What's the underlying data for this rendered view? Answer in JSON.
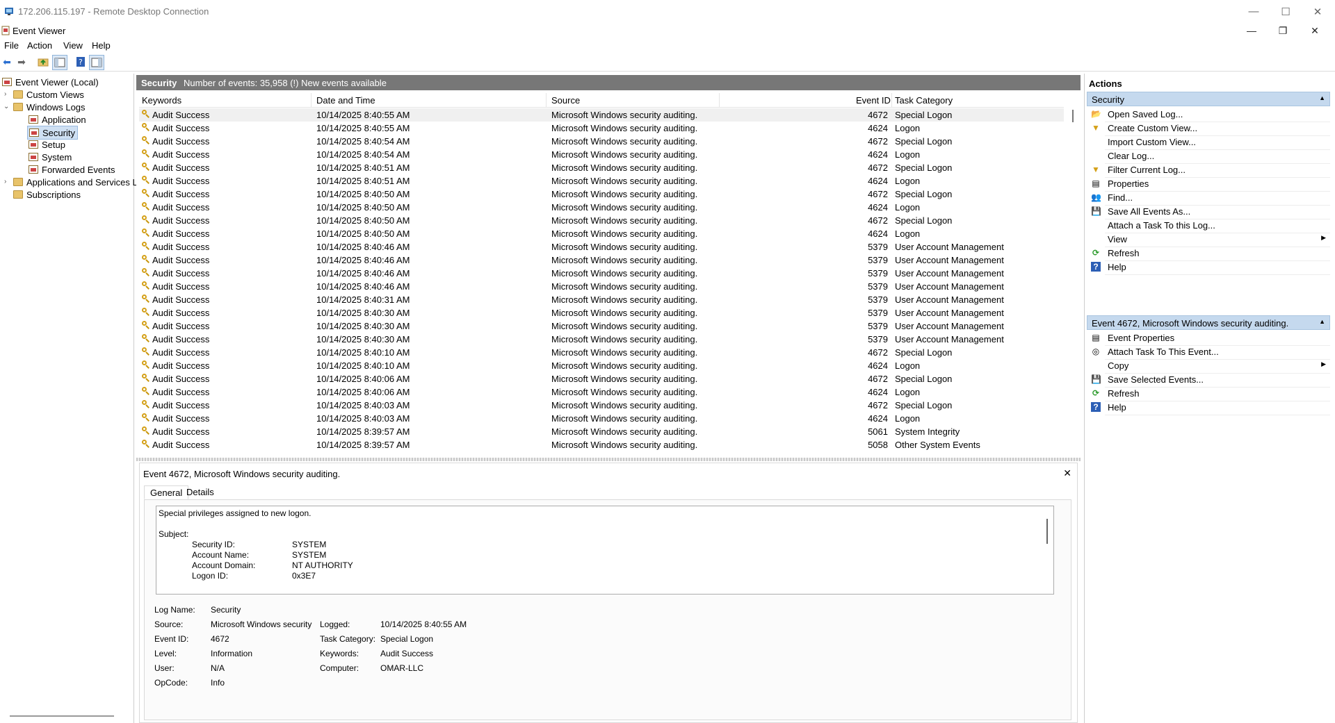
{
  "rdp": {
    "title": "172.206.115.197 - Remote Desktop Connection",
    "minimize": "—",
    "maximize": "☐",
    "close": "✕"
  },
  "app": {
    "title": "Event Viewer",
    "minimize": "—",
    "restore": "❐",
    "close": "✕"
  },
  "menu": [
    "File",
    "Action",
    "View",
    "Help"
  ],
  "tree": {
    "root": "Event Viewer (Local)",
    "custom_views": "Custom Views",
    "windows_logs": "Windows Logs",
    "application": "Application",
    "security": "Security",
    "setup": "Setup",
    "system": "System",
    "forwarded": "Forwarded Events",
    "apps_services": "Applications and Services Lo",
    "subscriptions": "Subscriptions"
  },
  "list": {
    "log_name": "Security",
    "summary": "Number of events: 35,958 (!) New events available",
    "columns": [
      "Keywords",
      "Date and Time",
      "Source",
      "Event ID",
      "Task Category"
    ],
    "rows": [
      [
        "Audit Success",
        "10/14/2025 8:40:55 AM",
        "Microsoft Windows security auditing.",
        "4672",
        "Special Logon"
      ],
      [
        "Audit Success",
        "10/14/2025 8:40:55 AM",
        "Microsoft Windows security auditing.",
        "4624",
        "Logon"
      ],
      [
        "Audit Success",
        "10/14/2025 8:40:54 AM",
        "Microsoft Windows security auditing.",
        "4672",
        "Special Logon"
      ],
      [
        "Audit Success",
        "10/14/2025 8:40:54 AM",
        "Microsoft Windows security auditing.",
        "4624",
        "Logon"
      ],
      [
        "Audit Success",
        "10/14/2025 8:40:51 AM",
        "Microsoft Windows security auditing.",
        "4672",
        "Special Logon"
      ],
      [
        "Audit Success",
        "10/14/2025 8:40:51 AM",
        "Microsoft Windows security auditing.",
        "4624",
        "Logon"
      ],
      [
        "Audit Success",
        "10/14/2025 8:40:50 AM",
        "Microsoft Windows security auditing.",
        "4672",
        "Special Logon"
      ],
      [
        "Audit Success",
        "10/14/2025 8:40:50 AM",
        "Microsoft Windows security auditing.",
        "4624",
        "Logon"
      ],
      [
        "Audit Success",
        "10/14/2025 8:40:50 AM",
        "Microsoft Windows security auditing.",
        "4672",
        "Special Logon"
      ],
      [
        "Audit Success",
        "10/14/2025 8:40:50 AM",
        "Microsoft Windows security auditing.",
        "4624",
        "Logon"
      ],
      [
        "Audit Success",
        "10/14/2025 8:40:46 AM",
        "Microsoft Windows security auditing.",
        "5379",
        "User Account Management"
      ],
      [
        "Audit Success",
        "10/14/2025 8:40:46 AM",
        "Microsoft Windows security auditing.",
        "5379",
        "User Account Management"
      ],
      [
        "Audit Success",
        "10/14/2025 8:40:46 AM",
        "Microsoft Windows security auditing.",
        "5379",
        "User Account Management"
      ],
      [
        "Audit Success",
        "10/14/2025 8:40:46 AM",
        "Microsoft Windows security auditing.",
        "5379",
        "User Account Management"
      ],
      [
        "Audit Success",
        "10/14/2025 8:40:31 AM",
        "Microsoft Windows security auditing.",
        "5379",
        "User Account Management"
      ],
      [
        "Audit Success",
        "10/14/2025 8:40:30 AM",
        "Microsoft Windows security auditing.",
        "5379",
        "User Account Management"
      ],
      [
        "Audit Success",
        "10/14/2025 8:40:30 AM",
        "Microsoft Windows security auditing.",
        "5379",
        "User Account Management"
      ],
      [
        "Audit Success",
        "10/14/2025 8:40:30 AM",
        "Microsoft Windows security auditing.",
        "5379",
        "User Account Management"
      ],
      [
        "Audit Success",
        "10/14/2025 8:40:10 AM",
        "Microsoft Windows security auditing.",
        "4672",
        "Special Logon"
      ],
      [
        "Audit Success",
        "10/14/2025 8:40:10 AM",
        "Microsoft Windows security auditing.",
        "4624",
        "Logon"
      ],
      [
        "Audit Success",
        "10/14/2025 8:40:06 AM",
        "Microsoft Windows security auditing.",
        "4672",
        "Special Logon"
      ],
      [
        "Audit Success",
        "10/14/2025 8:40:06 AM",
        "Microsoft Windows security auditing.",
        "4624",
        "Logon"
      ],
      [
        "Audit Success",
        "10/14/2025 8:40:03 AM",
        "Microsoft Windows security auditing.",
        "4672",
        "Special Logon"
      ],
      [
        "Audit Success",
        "10/14/2025 8:40:03 AM",
        "Microsoft Windows security auditing.",
        "4624",
        "Logon"
      ],
      [
        "Audit Success",
        "10/14/2025 8:39:57 AM",
        "Microsoft Windows security auditing.",
        "5061",
        "System Integrity"
      ],
      [
        "Audit Success",
        "10/14/2025 8:39:57 AM",
        "Microsoft Windows security auditing.",
        "5058",
        "Other System Events"
      ]
    ]
  },
  "detail": {
    "title": "Event 4672, Microsoft Windows security auditing.",
    "close": "✕",
    "tabs": [
      "General",
      "Details"
    ],
    "message": {
      "line1": "Special privileges assigned to new logon.",
      "subject": "Subject:",
      "fields": [
        [
          "Security ID:",
          "SYSTEM"
        ],
        [
          "Account Name:",
          "SYSTEM"
        ],
        [
          "Account Domain:",
          "NT AUTHORITY"
        ],
        [
          "Logon ID:",
          "0x3E7"
        ]
      ]
    },
    "props": {
      "log_name_label": "Log Name:",
      "log_name": "Security",
      "source_label": "Source:",
      "source": "Microsoft Windows security",
      "logged_label": "Logged:",
      "logged": "10/14/2025 8:40:55 AM",
      "event_id_label": "Event ID:",
      "event_id": "4672",
      "task_cat_label": "Task Category:",
      "task_cat": "Special Logon",
      "level_label": "Level:",
      "level": "Information",
      "keywords_label": "Keywords:",
      "keywords": "Audit Success",
      "user_label": "User:",
      "user": "N/A",
      "computer_label": "Computer:",
      "computer": "OMAR-LLC",
      "opcode_label": "OpCode:",
      "opcode": "Info"
    }
  },
  "actions": {
    "header": "Actions",
    "section1": "Security",
    "items1": [
      {
        "label": "Open Saved Log...",
        "icon": "open-log-icon",
        "glyph": "📂"
      },
      {
        "label": "Create Custom View...",
        "icon": "filter-icon",
        "glyph": "▼"
      },
      {
        "label": "Import Custom View...",
        "icon": "",
        "glyph": ""
      },
      {
        "label": "Clear Log...",
        "icon": "",
        "glyph": ""
      },
      {
        "label": "Filter Current Log...",
        "icon": "filter-icon",
        "glyph": "▼"
      },
      {
        "label": "Properties",
        "icon": "properties-icon",
        "glyph": "▤"
      },
      {
        "label": "Find...",
        "icon": "find-icon",
        "glyph": "👥"
      },
      {
        "label": "Save All Events As...",
        "icon": "save-icon",
        "glyph": "💾"
      },
      {
        "label": "Attach a Task To this Log...",
        "icon": "",
        "glyph": ""
      },
      {
        "label": "View",
        "icon": "",
        "glyph": "",
        "submenu": "▶"
      },
      {
        "label": "Refresh",
        "icon": "refresh-icon",
        "glyph": "⟳"
      },
      {
        "label": "Help",
        "icon": "help-icon",
        "glyph": "?"
      }
    ],
    "section2": "Event 4672, Microsoft Windows security auditing.",
    "items2": [
      {
        "label": "Event Properties",
        "icon": "properties-icon",
        "glyph": "▤"
      },
      {
        "label": "Attach Task To This Event...",
        "icon": "task-icon",
        "glyph": "◎"
      },
      {
        "label": "Copy",
        "icon": "",
        "glyph": "",
        "submenu": "▶"
      },
      {
        "label": "Save Selected Events...",
        "icon": "save-icon",
        "glyph": "💾"
      },
      {
        "label": "Refresh",
        "icon": "refresh-icon",
        "glyph": "⟳"
      },
      {
        "label": "Help",
        "icon": "help-icon",
        "glyph": "?"
      }
    ],
    "caret": "▲"
  },
  "colors": {
    "list_header_bg": "#777777",
    "section_bg": "#c5d9ee",
    "selection_bg": "#cfe0f3"
  }
}
